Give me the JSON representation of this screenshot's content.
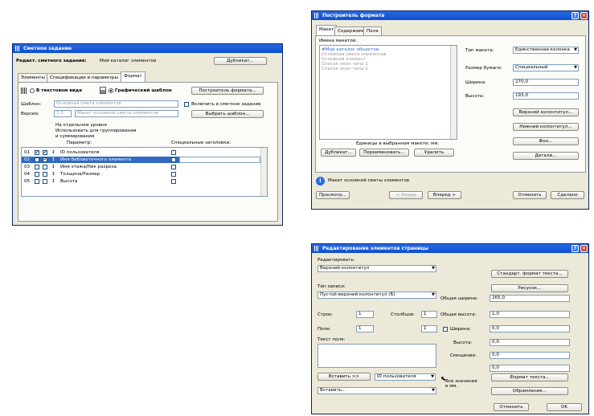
{
  "w1": {
    "title": "Сметное задание",
    "edit_label": "Редакт. сметного задания:",
    "edit_value": "Мой каталог элементов",
    "duplicate_btn": "Дубликат...",
    "tabs": [
      "Элементы",
      "Спецификации и параметры",
      "Формат"
    ],
    "text_view": "В текстовом виде",
    "graphic_template": "Графический шаблон",
    "format_builder_btn": "Построитель формата...",
    "template_label": "Шаблон:",
    "template_value": "Основная смета элементов",
    "include_label": "Включить в сметное задание",
    "version_label": "Версия:",
    "version_num": "1.0",
    "version_value": "Макет основной сметы элементов",
    "choose_template_btn": "Выбрать шаблон...",
    "separate_level": "На отдельном уровне",
    "use_for_grouping": "Использовать для группирования",
    "and_summing": "и суммирования",
    "param_header": "Параметр:",
    "special_headers": "Специальные заголовки:",
    "rows": [
      {
        "num": "01",
        "label": "ID пользователя"
      },
      {
        "num": "02",
        "label": "Имя библиотечного элемента"
      },
      {
        "num": "03",
        "label": "Имя этажа/Ник разреза"
      },
      {
        "num": "04",
        "label": "Толщина/Размер"
      },
      {
        "num": "05",
        "label": "Высота"
      }
    ]
  },
  "w2": {
    "title": "Построитель формата",
    "tabs": [
      "Макет",
      "Содержимое",
      "Поля"
    ],
    "layouts_label": "Имена макетов:",
    "layouts": [
      "#Мой каталог объектов",
      "Основная смета элементов",
      "Основной элемент",
      "Список окон типа 1",
      "Список окон типа 2"
    ],
    "units_note": "Единицы в выбранном макете: мм.",
    "duplicate_btn": "Дубликат...",
    "rename_btn": "Переименовать...",
    "delete_btn": "Удалить",
    "layout_type_label": "Тип макета:",
    "layout_type_value": "Единственная колонка",
    "paper_size_label": "Размер бумаги:",
    "paper_size_value": "Специальный",
    "width_label": "Ширина:",
    "width_value": "270,0",
    "height_label": "Высота:",
    "height_value": "193,0",
    "header_btn": "Верхний колонтитул...",
    "footer_btn": "Нижний колонтитул...",
    "background_btn": "Фон...",
    "details_btn": "Детали...",
    "info_text": "Макет основной сметы элементов",
    "preview_btn": "Просмотр...",
    "back_btn": "< Назад",
    "forward_btn": "Вперед >",
    "cancel_btn": "Отменить",
    "done_btn": "Сделано"
  },
  "w3": {
    "title": "Редактирование элементов страницы",
    "edit_label": "Редактировать:",
    "edit_value": "Верхний колонтитул",
    "std_format_btn": "Стандарт. формат текста...",
    "picture_btn": "Рисунок...",
    "record_type_label": "Тип записи:",
    "record_type_value": "Пустой верхний колонтитул (Б)",
    "total_width_label": "Общая ширина:",
    "total_width_value": "265,0",
    "rows_label": "Строк:",
    "rows_value": "1",
    "cols_label": "Столбцов:",
    "cols_value": "1",
    "total_height_label": "Общая высота:",
    "total_height_value": "1,0",
    "field_label": "Поле:",
    "field_value1": "1",
    "field_value2": "1",
    "width_label": "Ширина:",
    "width_value": "0,0",
    "height_label": "Высота:",
    "height_value": "0,0",
    "offset_label": "Смещение:",
    "offset_value": "0,0",
    "extra_value": "0,0",
    "field_text_label": "Текст поля:",
    "insert_btn": "Вставить >>",
    "user_id_value": "ID пользователя",
    "values_in_mm": "Все значения в мм.",
    "insert_select": "Вставить...",
    "text_format_btn": "Формат текста...",
    "border_btn": "Обрамление...",
    "cancel_btn": "Отменить",
    "ok_btn": "OK"
  }
}
